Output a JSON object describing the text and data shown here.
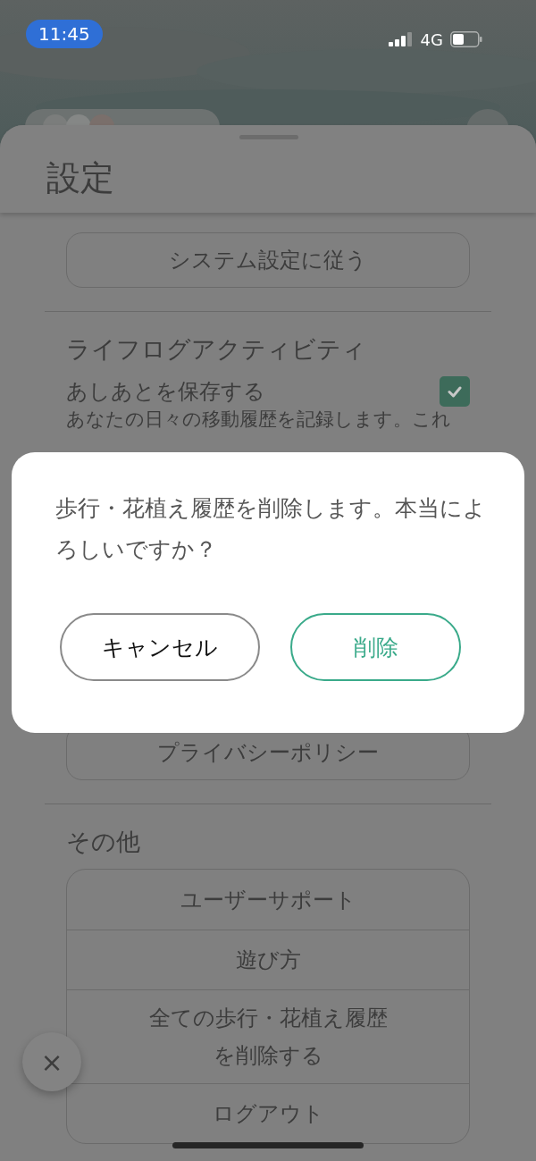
{
  "status_bar": {
    "time": "11:45",
    "network": "4G"
  },
  "sheet": {
    "title": "設定",
    "sections": [
      {
        "items": [
          {
            "kind": "button",
            "label": "システム設定に従う"
          }
        ]
      },
      {
        "title": "ライフログアクティビティ",
        "items": [
          {
            "kind": "checkbox",
            "label": "あしあとを保存する",
            "description": "あなたの日々の移動履歴を記録します。これ",
            "checked": true
          },
          {
            "kind": "button",
            "label": "プライバシーポリシー"
          }
        ]
      },
      {
        "title": "その他",
        "items": [
          {
            "kind": "list",
            "rows": [
              "ユーザーサポート",
              "遊び方",
              "全ての歩行・花植え履歴を削除する",
              "ログアウト"
            ]
          }
        ]
      }
    ]
  },
  "dialog": {
    "message": "歩行・花植え履歴を削除します。本当によろしいですか？",
    "buttons": [
      {
        "kind": "cancel",
        "label": "キャンセル"
      },
      {
        "kind": "destructive",
        "label": "削除"
      }
    ]
  },
  "close_button": {
    "label": "×"
  }
}
